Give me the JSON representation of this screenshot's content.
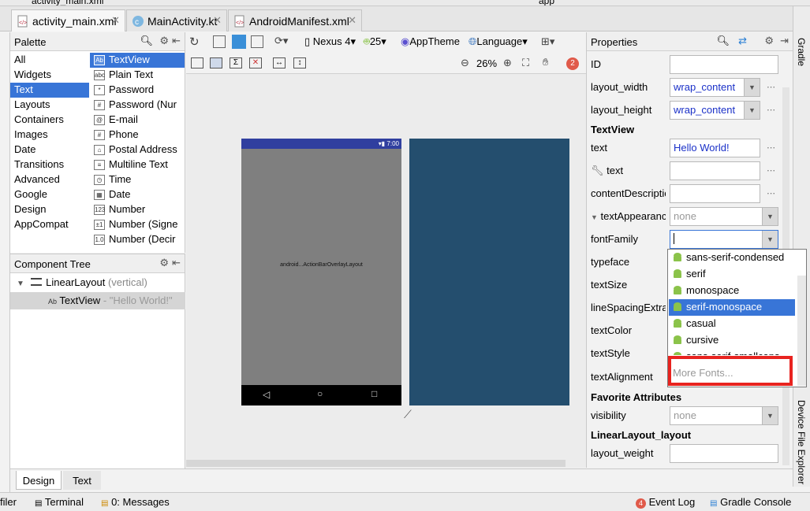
{
  "topstrip": {
    "file": "activity_main.xml",
    "app": "app"
  },
  "tabs": [
    {
      "label": "activity_main.xml"
    },
    {
      "label": "MainActivity.kt"
    },
    {
      "label": "AndroidManifest.xml"
    }
  ],
  "palette": {
    "title": "Palette",
    "categories": [
      "All",
      "Widgets",
      "Text",
      "Layouts",
      "Containers",
      "Images",
      "Date",
      "Transitions",
      "Advanced",
      "Google",
      "Design",
      "AppCompat"
    ],
    "selected_category": "Text",
    "widgets": [
      {
        "icon": "Ab",
        "label": "TextView"
      },
      {
        "icon": "abc",
        "label": "Plain Text"
      },
      {
        "icon": "*",
        "label": "Password"
      },
      {
        "icon": "#",
        "label": "Password (Nur"
      },
      {
        "icon": "@",
        "label": "E-mail"
      },
      {
        "icon": "#",
        "label": "Phone"
      },
      {
        "icon": "⌂",
        "label": "Postal Address"
      },
      {
        "icon": "≡",
        "label": "Multiline Text"
      },
      {
        "icon": "◷",
        "label": "Time"
      },
      {
        "icon": "▦",
        "label": "Date"
      },
      {
        "icon": "123",
        "label": "Number"
      },
      {
        "icon": "±1",
        "label": "Number (Signe"
      },
      {
        "icon": "1.0",
        "label": "Number (Decir"
      }
    ]
  },
  "component_tree": {
    "title": "Component Tree",
    "root": {
      "label": "LinearLayout",
      "detail": "(vertical)"
    },
    "child": {
      "icon": "Ab",
      "label": "TextView",
      "detail": "- \"Hello World!\""
    }
  },
  "toolbar": {
    "device": "Nexus 4",
    "api": "25",
    "theme": "AppTheme",
    "language": "Language",
    "zoom": "26%",
    "warnings": "2"
  },
  "phone": {
    "time": "7:00",
    "overlay_label": "android...ActionBarOverlayLayout"
  },
  "properties": {
    "title": "Properties",
    "rows": [
      {
        "label": "ID",
        "value": ""
      },
      {
        "label": "layout_width",
        "value": "wrap_content"
      },
      {
        "label": "layout_height",
        "value": "wrap_content"
      }
    ],
    "section_textview": "TextView",
    "text_label": "text",
    "text_value": "Hello World!",
    "tools_text_label": "text",
    "content_desc_label": "contentDescriptio",
    "text_appearance_label": "textAppearanc",
    "text_appearance_value": "none",
    "font_family_label": "fontFamily",
    "typeface_label": "typeface",
    "text_size_label": "textSize",
    "line_spacing_label": "lineSpacingExtra",
    "text_color_label": "textColor",
    "text_style_label": "textStyle",
    "text_alignment_label": "textAlignment",
    "section_favorite": "Favorite Attributes",
    "visibility_label": "visibility",
    "visibility_value": "none",
    "section_linear": "LinearLayout_layout",
    "layout_weight_label": "layout_weight"
  },
  "font_dropdown": {
    "items": [
      "sans-serif-condensed",
      "serif",
      "monospace",
      "serif-monospace",
      "casual",
      "cursive",
      "sans-serif-smallcaps"
    ],
    "selected": "serif-monospace",
    "more": "More Fonts..."
  },
  "bottom_tabs": {
    "design": "Design",
    "text": "Text"
  },
  "statusbar": {
    "profiler": "filer",
    "terminal": "Terminal",
    "messages": "0: Messages",
    "event_log_count": "4",
    "event_log": "Event Log",
    "gradle_console": "Gradle Console"
  },
  "right_strip": {
    "gradle": "Gradle",
    "device_file": "Device File Explorer"
  },
  "colors": {
    "accent": "#3875d7",
    "highlight": "#e8231f",
    "blueprint": "#244e6e",
    "statusbar_phone": "#303f9f"
  }
}
